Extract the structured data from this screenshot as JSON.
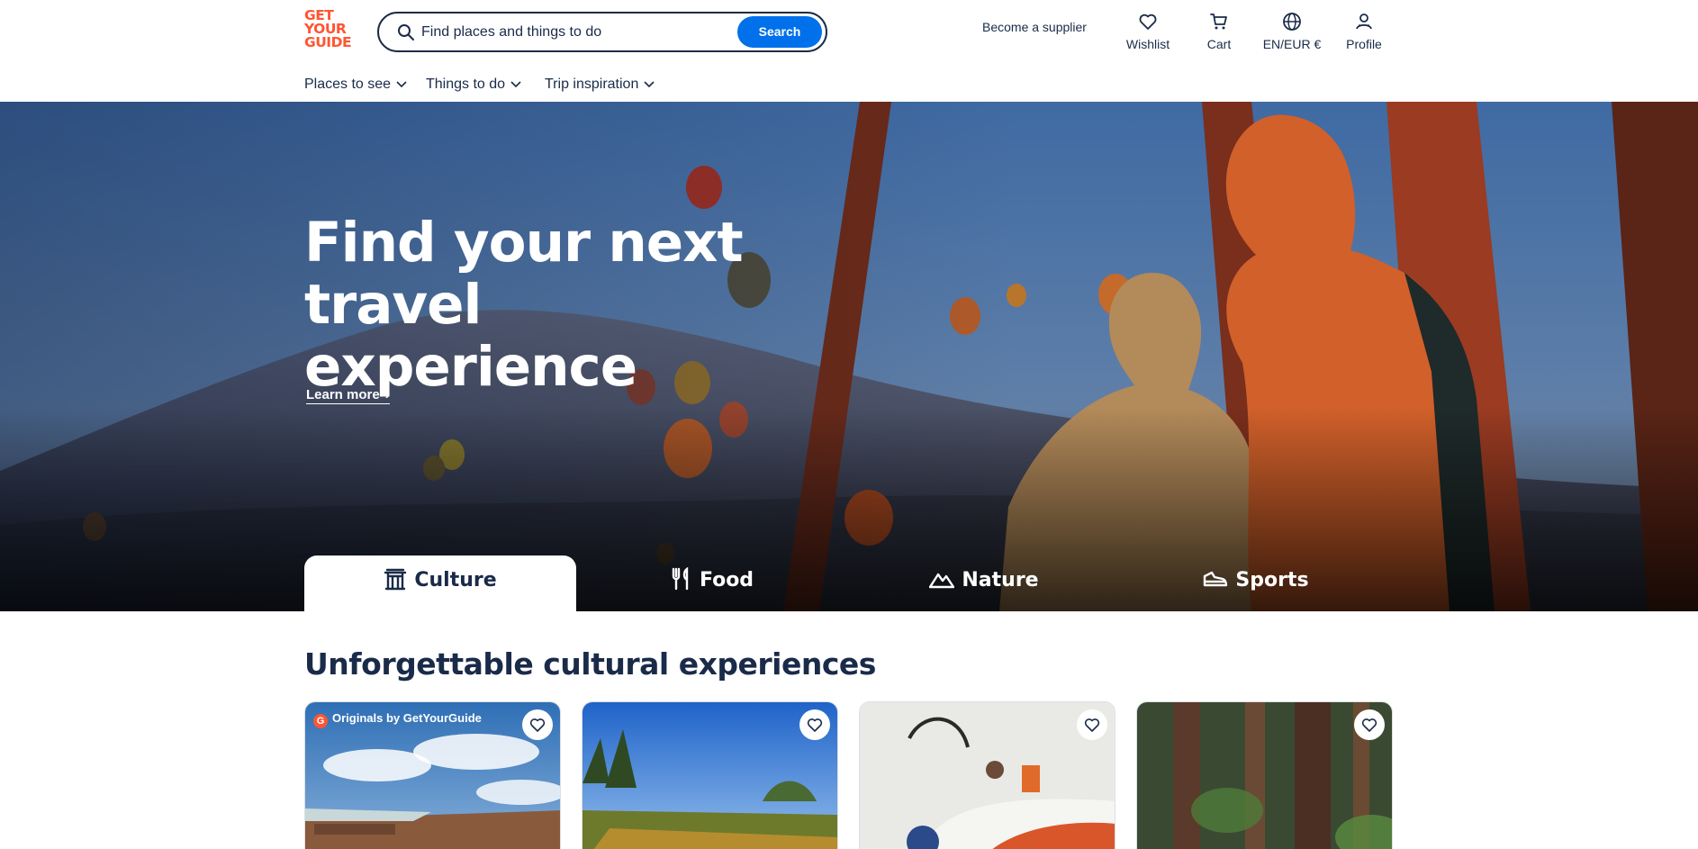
{
  "header": {
    "logo_lines": [
      "GET",
      "YOUR",
      "GUIDE"
    ],
    "search_placeholder": "Find places and things to do",
    "search_button": "Search",
    "become_supplier": "Become a supplier",
    "wishlist": "Wishlist",
    "cart": "Cart",
    "language": "EN/EUR €",
    "profile": "Profile"
  },
  "nav": {
    "items": [
      "Places to see",
      "Things to do",
      "Trip inspiration"
    ]
  },
  "hero": {
    "title_line1": "Find your next travel",
    "title_line2": "experience",
    "learn_more": "Learn more"
  },
  "tabs": [
    {
      "label": "Culture",
      "icon": "temple-icon",
      "active": true
    },
    {
      "label": "Food",
      "icon": "fork-knife-icon",
      "active": false
    },
    {
      "label": "Nature",
      "icon": "mountain-icon",
      "active": false
    },
    {
      "label": "Sports",
      "icon": "sneaker-icon",
      "active": false
    }
  ],
  "section": {
    "title": "Unforgettable cultural experiences"
  },
  "cards": [
    {
      "badge": "Originals by GetYourGuide",
      "badge_icon": "G"
    },
    {
      "badge": ""
    },
    {
      "badge": ""
    },
    {
      "badge": ""
    }
  ],
  "colors": {
    "brand": "#ff5533",
    "primary_blue": "#0071eb",
    "text_dark": "#1a2b49"
  }
}
